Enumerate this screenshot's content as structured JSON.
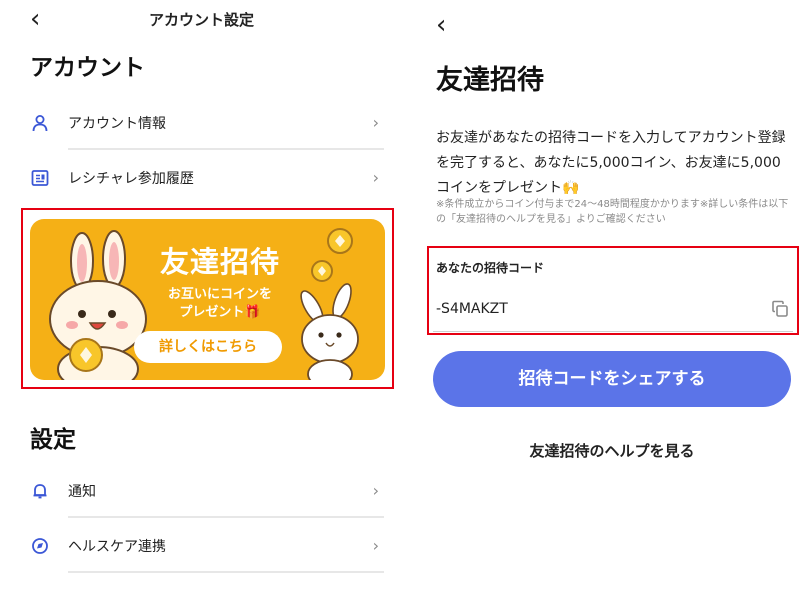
{
  "account_screen": {
    "back_glyph": "‹",
    "nav_title": "アカウント設定",
    "account_section_title": "アカウント",
    "account_items": [
      {
        "label": "アカウント情報",
        "icon": "person-icon"
      },
      {
        "label": "レシチャレ参加履歴",
        "icon": "receipt-history-icon"
      }
    ],
    "banner": {
      "title": "友達招待",
      "subtitle_line1": "お互いにコインを",
      "subtitle_line2": "プレゼント🎁",
      "button_label": "詳しくはこちら"
    },
    "settings_section_title": "設定",
    "settings_items": [
      {
        "label": "通知",
        "icon": "bell-icon"
      },
      {
        "label": "ヘルスケア連携",
        "icon": "healthcare-icon"
      }
    ]
  },
  "invite_screen": {
    "back_glyph": "‹",
    "title": "友達招待",
    "description": "お友達があなたの招待コードを入力してアカウント登録を完了すると、あなたに5,000コイン、お友達に5,000コインをプレゼント🙌",
    "note": "※条件成立からコイン付与まで24〜48時間程度かかります※詳しい条件は以下の「友達招待のヘルプを見る」よりご確認ください",
    "code_label": "あなたの招待コード",
    "code_value": "-S4MAKZT",
    "share_button_label": "招待コードをシェアする",
    "help_link_label": "友達招待のヘルプを見る"
  },
  "colors": {
    "accent_blue": "#5b74e8",
    "banner_yellow": "#f5b016",
    "highlight_red": "#e60012",
    "icon_blue": "#3b57d6"
  }
}
